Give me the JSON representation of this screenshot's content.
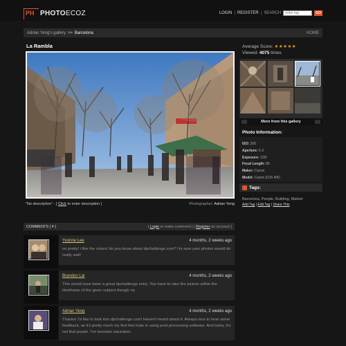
{
  "header": {
    "logo_ph": "PH",
    "logo_photo": "PHOTO",
    "logo_ecoz": "ECOZ",
    "login": "LOGIN",
    "register": "REGISTER",
    "search": "SEARCH",
    "search_placeholder": "enter tag",
    "go": "GO"
  },
  "breadcrumb": {
    "gallery": "Adrian Yeng's gallery",
    "separator": ">>",
    "current": "Barcelona",
    "home": "HOME"
  },
  "photo": {
    "title": "La Rambla",
    "caption_desc": "\"No description\"",
    "caption_pre": " - [ ",
    "caption_link": "Click",
    "caption_post": " to enter description ]",
    "photographer_label": "Photographer:",
    "photographer_name": "Adrian Yeng"
  },
  "stats": {
    "score_label": "Average Score:",
    "stars": "★★★★★",
    "viewed_label": "Viewed:",
    "viewed_count": "4075",
    "viewed_suffix": "times"
  },
  "gallery": {
    "more_label": "More from this gallery"
  },
  "info": {
    "heading": "Photo Information:",
    "rows": [
      {
        "label": "ISO:",
        "value": "200"
      },
      {
        "label": "Aperture:",
        "value": "6.3"
      },
      {
        "label": "Exposure:",
        "value": "1/30"
      },
      {
        "label": "Focal Length:",
        "value": "85"
      },
      {
        "label": "Maker:",
        "value": "Canon"
      },
      {
        "label": "Model:",
        "value": "Canon EOS 40D"
      }
    ]
  },
  "tags": {
    "heading": "Tags:",
    "list": "Barcelona, People, Building, Market",
    "add": "Add Tag",
    "edit": "Edit Tag",
    "share": "Share This"
  },
  "comments": {
    "header": "COMMENTS [ 4 ]",
    "login_pre": "[ ",
    "login": "Login",
    "login_mid": " to make comment ] [ ",
    "register": "Register",
    "register_post": " an account ]",
    "items": [
      {
        "name": "Yvonne Lee",
        "time": "4 months, 2 weeks ago",
        "text": "oo pretty! i like the colors! do you know about dpchallenge.com? i'm sure your photos would do really well!"
      },
      {
        "name": "Brandon Lai",
        "time": "4 months, 2 weeks ago",
        "text": "This would have been a great dpchallenge entry. You have to take the picture within the timeframe of the given subject though =p"
      },
      {
        "name": "Adrian Yeng",
        "time": "4 months, 2 weeks ago",
        "text": "Thanks! I'd like to look into dpchallenge.com! Haven't heard about it. Always nice to hear some feedback, as it's pretty much my first few trials in using post processing software. And haha, it's not that purple. I've boosted saturation."
      }
    ]
  },
  "colors": {
    "accent": "#e5532b",
    "star": "#f39a20",
    "comment_name": "#d8c878"
  }
}
